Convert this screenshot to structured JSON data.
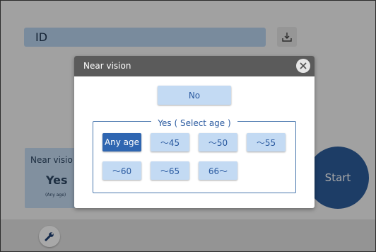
{
  "id_field": {
    "label": "ID"
  },
  "background": {
    "near_card": {
      "title": "Near visio",
      "value": "Yes",
      "sub": "(Any age)"
    },
    "start_label": "Start"
  },
  "modal": {
    "title": "Near vision",
    "no_label": "No",
    "group_label": "Yes ( Select age )",
    "age_options": [
      "Any age",
      "～45",
      "～50",
      "～55",
      "～60",
      "～65",
      "66～"
    ],
    "selected": "Any age"
  },
  "colors": {
    "accent": "#2f66b1",
    "button": "#c3daf3",
    "header": "#5b5b5b",
    "start": "#2c5d9c"
  },
  "icons": {
    "download": "download-icon",
    "close": "close-icon",
    "wrench": "wrench-icon"
  }
}
